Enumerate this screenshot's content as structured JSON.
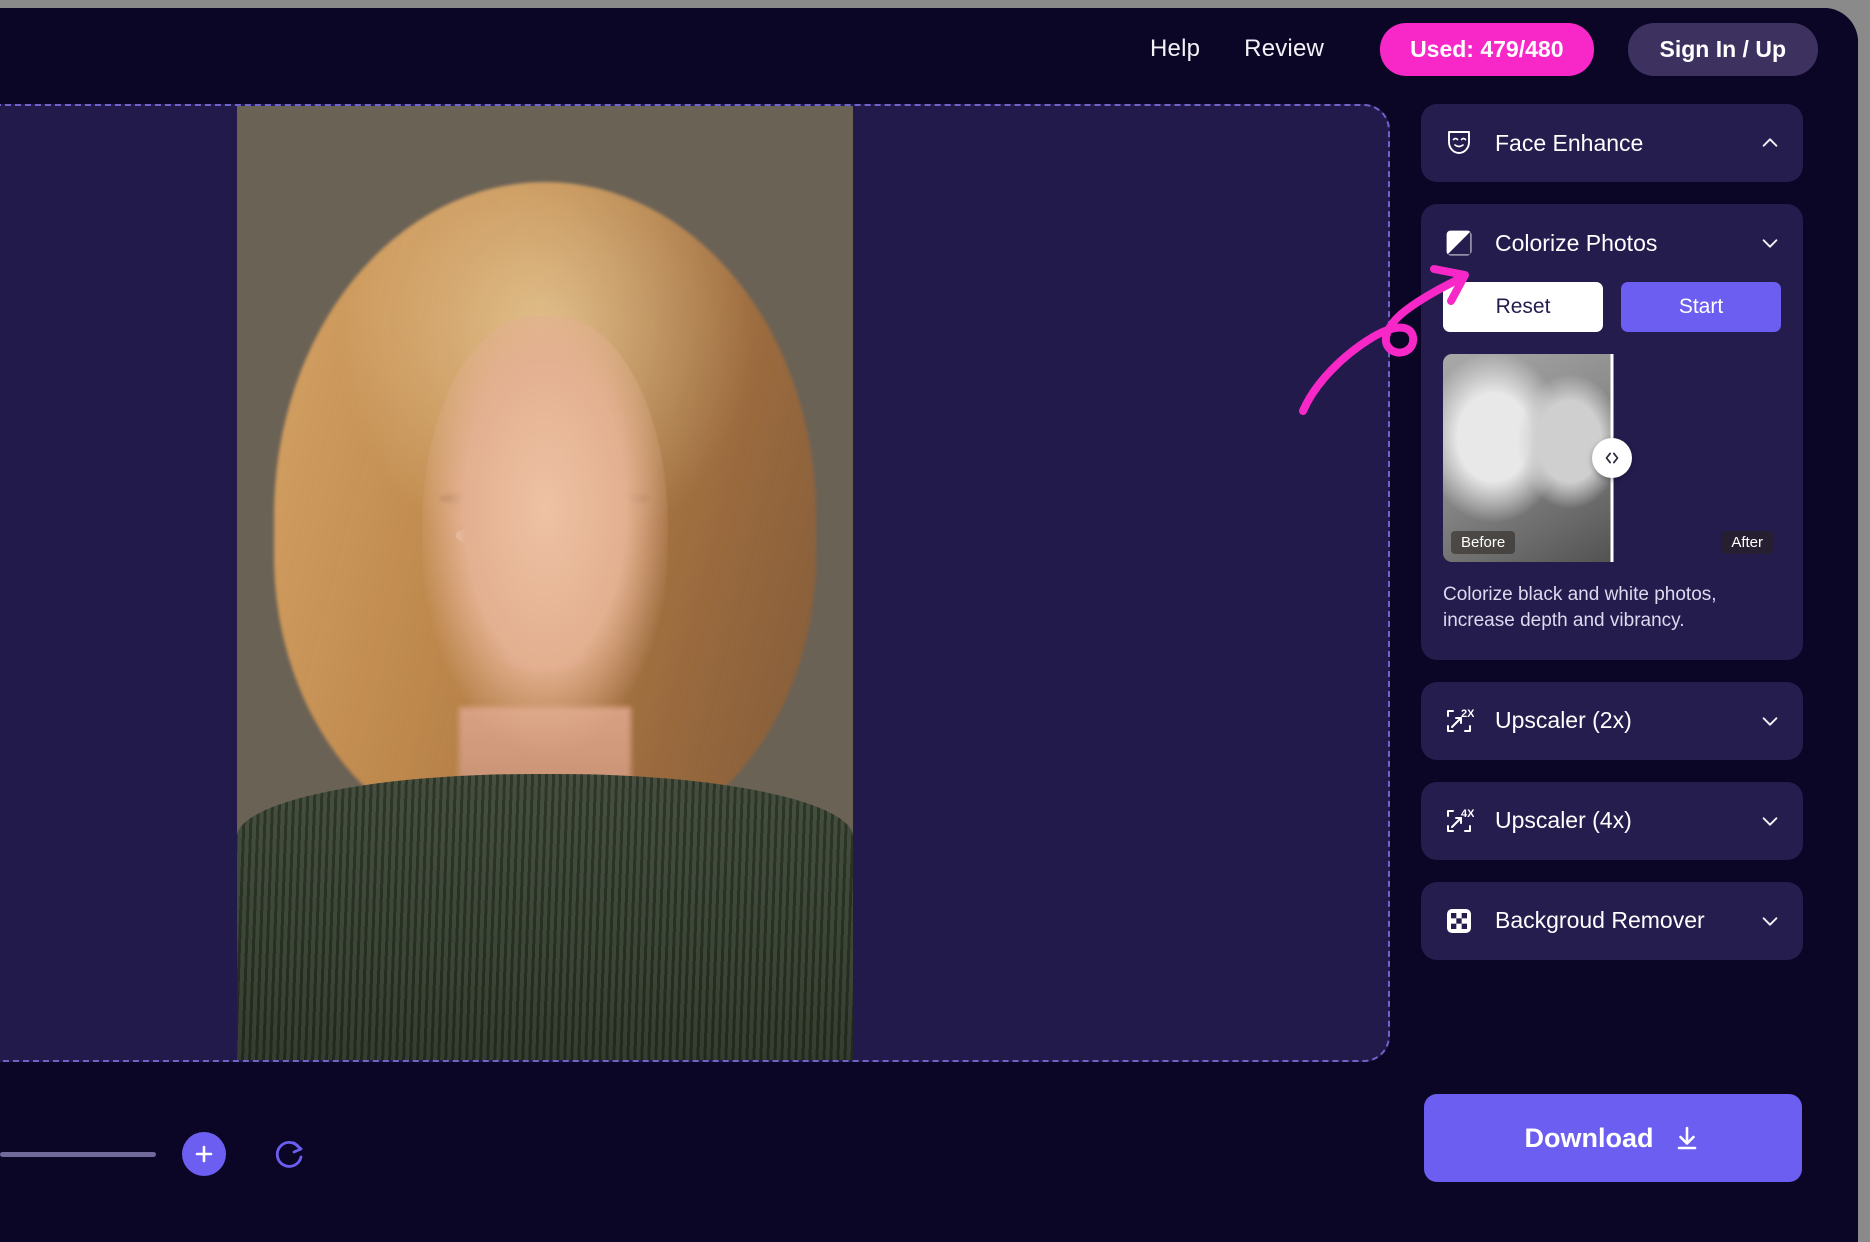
{
  "header": {
    "links": [
      {
        "label": "Help",
        "name": "help-link"
      },
      {
        "label": "Review",
        "name": "review-link"
      }
    ],
    "usage_badge": "Used: 479/480",
    "signin_label": "Sign In / Up",
    "badge_color": "#f828c8",
    "signin_color": "#3c315f"
  },
  "canvas": {
    "image_alt": "portrait-photo",
    "border_color": "#6f63c9",
    "background": "#211a4a"
  },
  "toolbar": {
    "zoom_slider_name": "zoom-slider",
    "add_icon": "plus-icon",
    "redo_icon": "redo-icon"
  },
  "sidebar": {
    "panels": [
      {
        "title": "Face Enhance",
        "icon": "smiling-face-icon",
        "chevron": "chevron-up-icon",
        "expanded": false
      },
      {
        "title": "Colorize Photos",
        "icon": "diagonal-split-square-icon",
        "chevron": "chevron-down-icon",
        "expanded": true,
        "reset_label": "Reset",
        "start_label": "Start",
        "before_label": "Before",
        "after_label": "After",
        "handle_icon": "left-right-chevrons-icon",
        "description": "Colorize black and white photos, increase depth and vibrancy.",
        "reset_bg": "#ffffff",
        "start_bg": "#6b5ef0"
      },
      {
        "title": "Upscaler (2x)",
        "icon": "upscale-2x-icon",
        "chevron": "chevron-down-icon",
        "expanded": false
      },
      {
        "title": "Upscaler (4x)",
        "icon": "upscale-4x-icon",
        "chevron": "chevron-down-icon",
        "expanded": false
      },
      {
        "title": "Backgroud Remover",
        "icon": "checkerboard-icon",
        "chevron": "chevron-down-icon",
        "expanded": false
      }
    ]
  },
  "download": {
    "label": "Download",
    "icon": "download-arrow-icon",
    "color": "#6b5ef0"
  },
  "annotation": {
    "type": "curly-arrow",
    "color": "#f828c8",
    "points_to": "Colorize Photos"
  }
}
